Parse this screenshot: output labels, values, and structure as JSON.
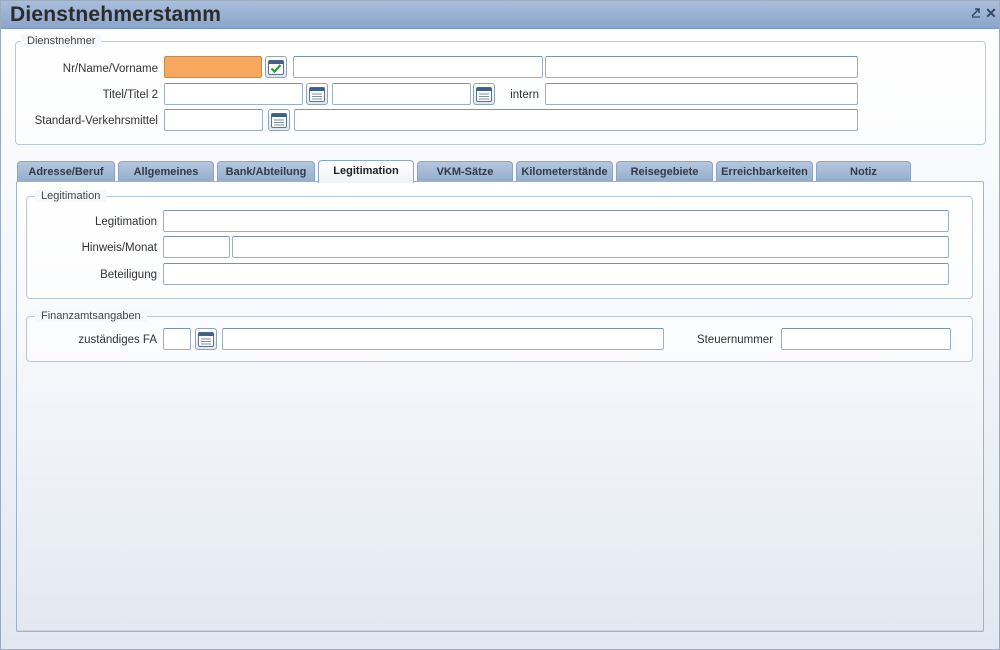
{
  "window": {
    "title": "Dienstnehmerstamm",
    "minimize_icon": "pin-icon",
    "close_label": "✕"
  },
  "dienstnehmer": {
    "legend": "Dienstnehmer",
    "row1_label": "Nr/Name/Vorname",
    "row2_label": "Titel/Titel 2",
    "intern_label": "intern",
    "row3_label": "Standard-Verkehrsmittel",
    "fields": {
      "nr": "",
      "name": "",
      "vorname": "",
      "titel": "",
      "titel2": "",
      "intern": "",
      "verkehrsmittel_code": "",
      "verkehrsmittel_text": ""
    }
  },
  "tabs": [
    {
      "label": "Adresse/Beruf",
      "active": false
    },
    {
      "label": "Allgemeines",
      "active": false
    },
    {
      "label": "Bank/Abteilung",
      "active": false
    },
    {
      "label": "Legitimation",
      "active": true
    },
    {
      "label": "VKM-Sätze",
      "active": false
    },
    {
      "label": "Kilometerstände",
      "active": false
    },
    {
      "label": "Reisegebiete",
      "active": false
    },
    {
      "label": "Erreichbarkeiten",
      "active": false
    },
    {
      "label": "Notiz",
      "active": false
    }
  ],
  "legitimation": {
    "legend": "Legitimation",
    "legitimation_label": "Legitimation",
    "hinweis_label": "Hinweis/Monat",
    "beteiligung_label": "Beteiligung",
    "fields": {
      "legitimation": "",
      "hinweis_monat": "",
      "hinweis_text": "",
      "beteiligung": ""
    }
  },
  "finanzamt": {
    "legend": "Finanzamtsangaben",
    "fa_label": "zuständiges FA",
    "steuernummer_label": "Steuernummer",
    "fields": {
      "fa_code": "",
      "fa_name": "",
      "steuernummer": ""
    }
  },
  "colors": {
    "active_field": "#f7a75e",
    "titlebar": "#8aa5cc",
    "tab": "#93adcc"
  }
}
